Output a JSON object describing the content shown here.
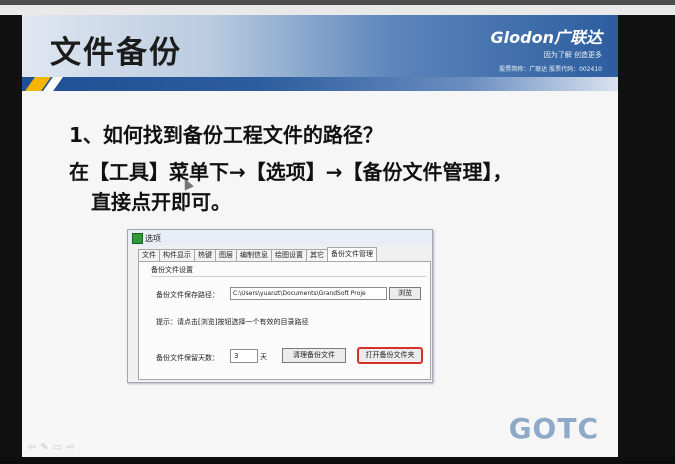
{
  "slide": {
    "title": "文件备份",
    "brand": {
      "name": "Glodon广联达",
      "slogan": "因为了解 创造更多",
      "stock": "股票简称：广联达   股票代码：002410"
    },
    "question_line1": "1、如何找到备份工程文件的路径？",
    "question_line2": "在【工具】菜单下→【选项】→【备份文件管理】，",
    "question_line3": "直接点开即可。",
    "logo_text": "GOTC",
    "controls": [
      "⇦",
      "✎",
      "▭",
      "⇨"
    ]
  },
  "dialog": {
    "title": "选项",
    "tabs": [
      "文件",
      "构件显示",
      "热键",
      "图层",
      "编制信息",
      "绘图设置",
      "其它",
      "备份文件管理"
    ],
    "active_tab": "备份文件管理",
    "group_label": "备份文件设置",
    "path_label": "备份文件保存路径：",
    "path_value": "C:\\Users\\yuanzt\\Documents\\GrandSoft Proje",
    "browse_label": "浏览",
    "hint": "提示：请点击[浏览]按钮选择一个有效的目录路径",
    "days_label": "备份文件保留天数：",
    "days_value": "3",
    "days_unit": "天",
    "clean_label": "清理备份文件",
    "open_label": "打开备份文件夹"
  },
  "colors": {
    "header_dark": "#2c5d9e",
    "accent_yellow": "#f4b400",
    "highlight_red": "#d6312a",
    "logo_blue": "#8fa9c9"
  }
}
